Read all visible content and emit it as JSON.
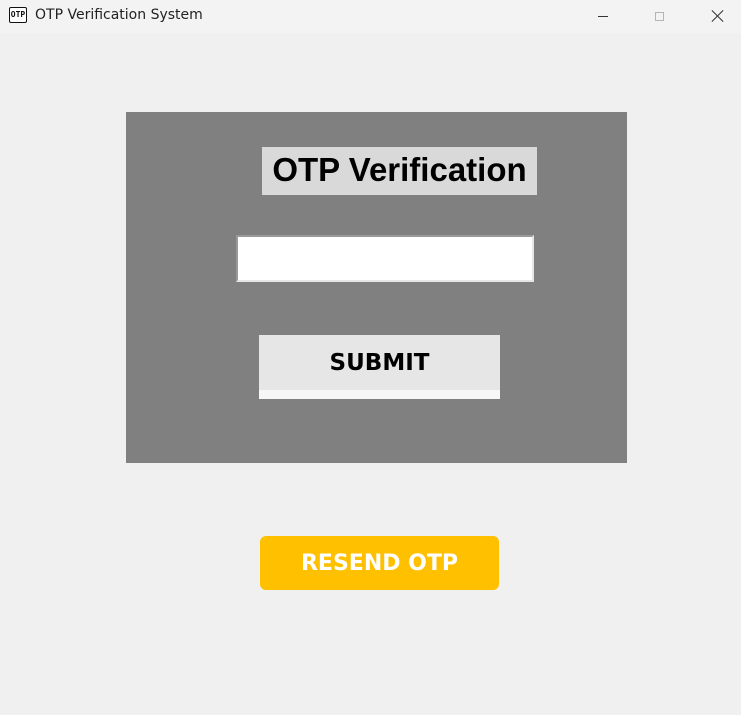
{
  "window": {
    "title": "OTP Verification System",
    "icon_text": "OTP",
    "icon": "otp-app-icon",
    "controls": {
      "minimize_icon": "minimize-icon",
      "maximize_icon": "maximize-icon",
      "close_icon": "close-icon"
    }
  },
  "form": {
    "heading": "OTP Verification",
    "otp_input": {
      "value": "",
      "placeholder": ""
    },
    "submit_label": "SUBMIT"
  },
  "resend": {
    "label": "RESEND OTP"
  },
  "colors": {
    "window_bg": "#f0f0f0",
    "panel_bg": "#808080",
    "heading_bg": "#d9d9d9",
    "submit_bg": "#e6e6e6",
    "resend_bg": "#ffc000",
    "resend_text": "#ffffff"
  }
}
